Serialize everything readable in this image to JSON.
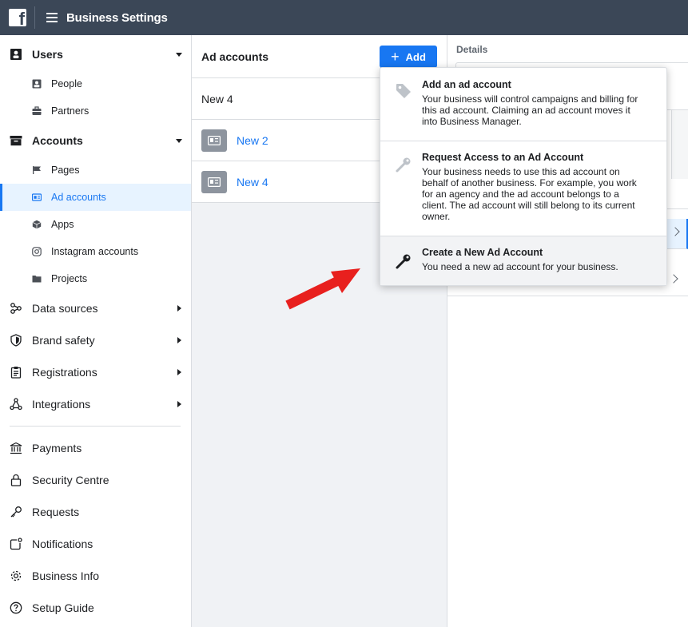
{
  "topbar": {
    "title": "Business Settings"
  },
  "sidebar": {
    "users": {
      "label": "Users",
      "items": [
        {
          "label": "People",
          "icon": "person-icon"
        },
        {
          "label": "Partners",
          "icon": "briefcase-icon"
        }
      ]
    },
    "accounts": {
      "label": "Accounts",
      "items": [
        {
          "label": "Pages",
          "icon": "flag-icon"
        },
        {
          "label": "Ad accounts",
          "icon": "ad-account-icon"
        },
        {
          "label": "Apps",
          "icon": "cube-icon"
        },
        {
          "label": "Instagram accounts",
          "icon": "instagram-icon"
        },
        {
          "label": "Projects",
          "icon": "folder-icon"
        }
      ]
    },
    "expandable": [
      {
        "label": "Data sources",
        "icon": "nodes-icon"
      },
      {
        "label": "Brand safety",
        "icon": "shield-icon"
      },
      {
        "label": "Registrations",
        "icon": "clipboard-icon"
      },
      {
        "label": "Integrations",
        "icon": "integrations-icon"
      }
    ],
    "bottom": [
      {
        "label": "Payments",
        "icon": "bank-icon"
      },
      {
        "label": "Security Centre",
        "icon": "lock-icon"
      },
      {
        "label": "Requests",
        "icon": "key-icon"
      },
      {
        "label": "Notifications",
        "icon": "bell-icon"
      },
      {
        "label": "Business Info",
        "icon": "gear-icon"
      },
      {
        "label": "Setup Guide",
        "icon": "help-icon"
      }
    ]
  },
  "middle": {
    "title": "Ad accounts",
    "add_label": "Add",
    "search_value": "New 4",
    "rows": [
      {
        "name": "New 2"
      },
      {
        "name": "New 4"
      }
    ]
  },
  "details": {
    "label": "Details"
  },
  "dropdown": {
    "items": [
      {
        "title": "Add an ad account",
        "desc": "Your business will control campaigns and billing for this ad account. Claiming an ad account moves it into Business Manager.",
        "icon": "tag-icon"
      },
      {
        "title": "Request Access to an Ad Account",
        "desc": "Your business needs to use this ad account on behalf of another business. For example, you work for an agency and the ad account belongs to a client. The ad account will still belong to its current owner.",
        "icon": "key-icon"
      },
      {
        "title": "Create a New Ad Account",
        "desc": "You need a new ad account for your business.",
        "icon": "key-icon"
      }
    ]
  },
  "colors": {
    "topbar": "#3b4757",
    "accent": "#1877f2",
    "arrow": "#e8201e"
  }
}
